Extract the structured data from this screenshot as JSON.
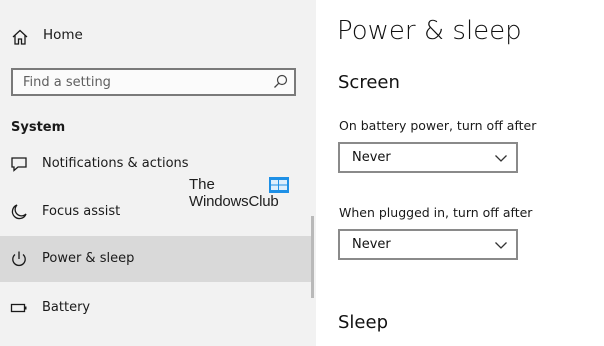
{
  "sidebar": {
    "home_label": "Home",
    "search_placeholder": "Find a setting",
    "section_title": "System",
    "items": [
      {
        "label": "Notifications & actions",
        "icon": "notifications-icon"
      },
      {
        "label": "Focus assist",
        "icon": "moon-icon"
      },
      {
        "label": "Power & sleep",
        "icon": "power-icon",
        "selected": true
      },
      {
        "label": "Battery",
        "icon": "battery-icon"
      }
    ]
  },
  "watermark": {
    "line1": "The",
    "line2": "WindowsClub",
    "logo_color": "#1e90e6"
  },
  "main": {
    "title": "Power & sleep",
    "screen_group": {
      "title": "Screen",
      "battery_label": "On battery power, turn off after",
      "battery_value": "Never",
      "plugged_label": "When plugged in, turn off after",
      "plugged_value": "Never"
    },
    "sleep_group": {
      "title": "Sleep"
    }
  },
  "colors": {
    "sidebar_bg": "#f2f2f2",
    "selected_bg": "#d9d9d9",
    "border": "#8a8a8a"
  }
}
